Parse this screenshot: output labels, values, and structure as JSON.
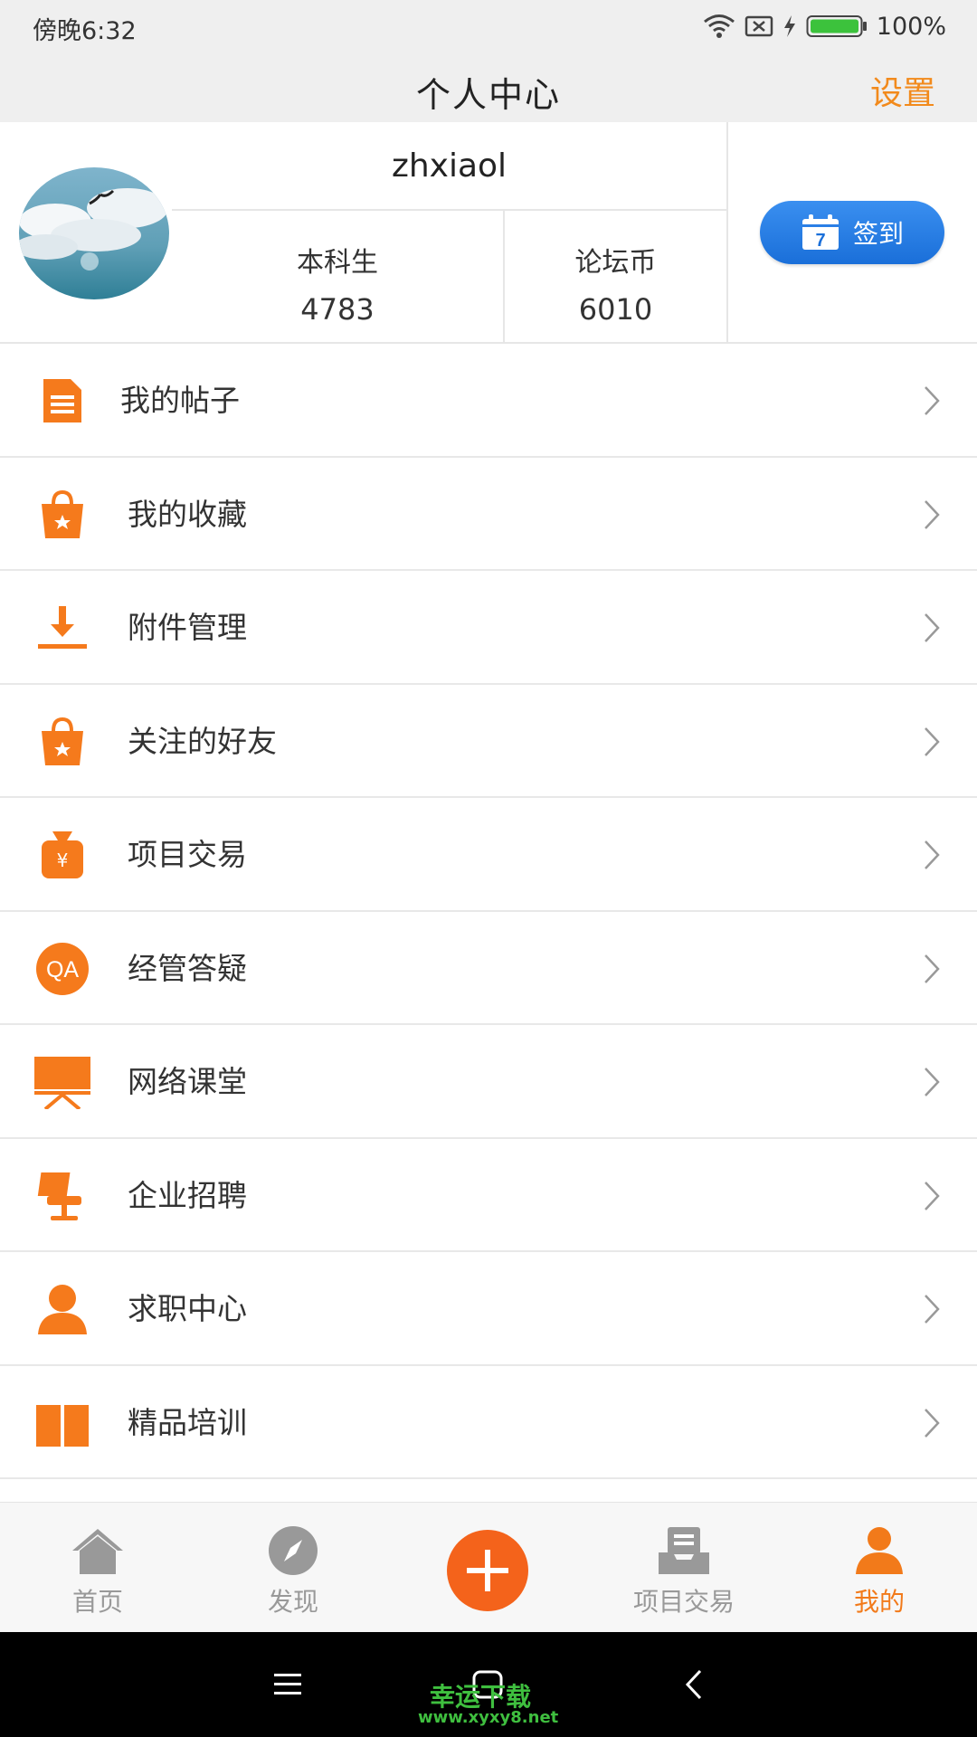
{
  "status_bar": {
    "time": "傍晚6:32",
    "battery": "100%",
    "icons": [
      "wifi-icon",
      "sim-icon",
      "charging-icon",
      "battery-icon"
    ]
  },
  "header": {
    "title": "个人中心",
    "settings_label": "设置"
  },
  "profile": {
    "username": "zhxiaol",
    "stats": [
      {
        "label": "本科生",
        "value": "4783"
      },
      {
        "label": "论坛币",
        "value": "6010"
      }
    ],
    "checkin_label": "签到",
    "checkin_icon_day": "7"
  },
  "menu": [
    {
      "label": "我的帖子",
      "icon": "document-icon"
    },
    {
      "label": "我的收藏",
      "icon": "bag-star-icon"
    },
    {
      "label": "附件管理",
      "icon": "download-icon"
    },
    {
      "label": "关注的好友",
      "icon": "bag-star-icon"
    },
    {
      "label": "项目交易",
      "icon": "money-bag-icon"
    },
    {
      "label": "经管答疑",
      "icon": "qa-icon",
      "icon_text": "QA"
    },
    {
      "label": "网络课堂",
      "icon": "classroom-board-icon"
    },
    {
      "label": "企业招聘",
      "icon": "office-chair-icon"
    },
    {
      "label": "求职中心",
      "icon": "person-icon"
    },
    {
      "label": "精品培训",
      "icon": "book-icon"
    }
  ],
  "bottom_nav": [
    {
      "label": "首页",
      "icon": "home-icon"
    },
    {
      "label": "发现",
      "icon": "compass-icon"
    },
    {
      "label": "",
      "icon": "add-icon"
    },
    {
      "label": "项目交易",
      "icon": "inbox-icon"
    },
    {
      "label": "我的",
      "icon": "profile-icon",
      "active": true
    }
  ],
  "colors": {
    "accent": "#f27a1a",
    "checkin_blue": "#1a6fd9",
    "inactive": "#999999"
  },
  "watermark": {
    "title": "幸运下载",
    "url": "www.xyxy8.net"
  }
}
